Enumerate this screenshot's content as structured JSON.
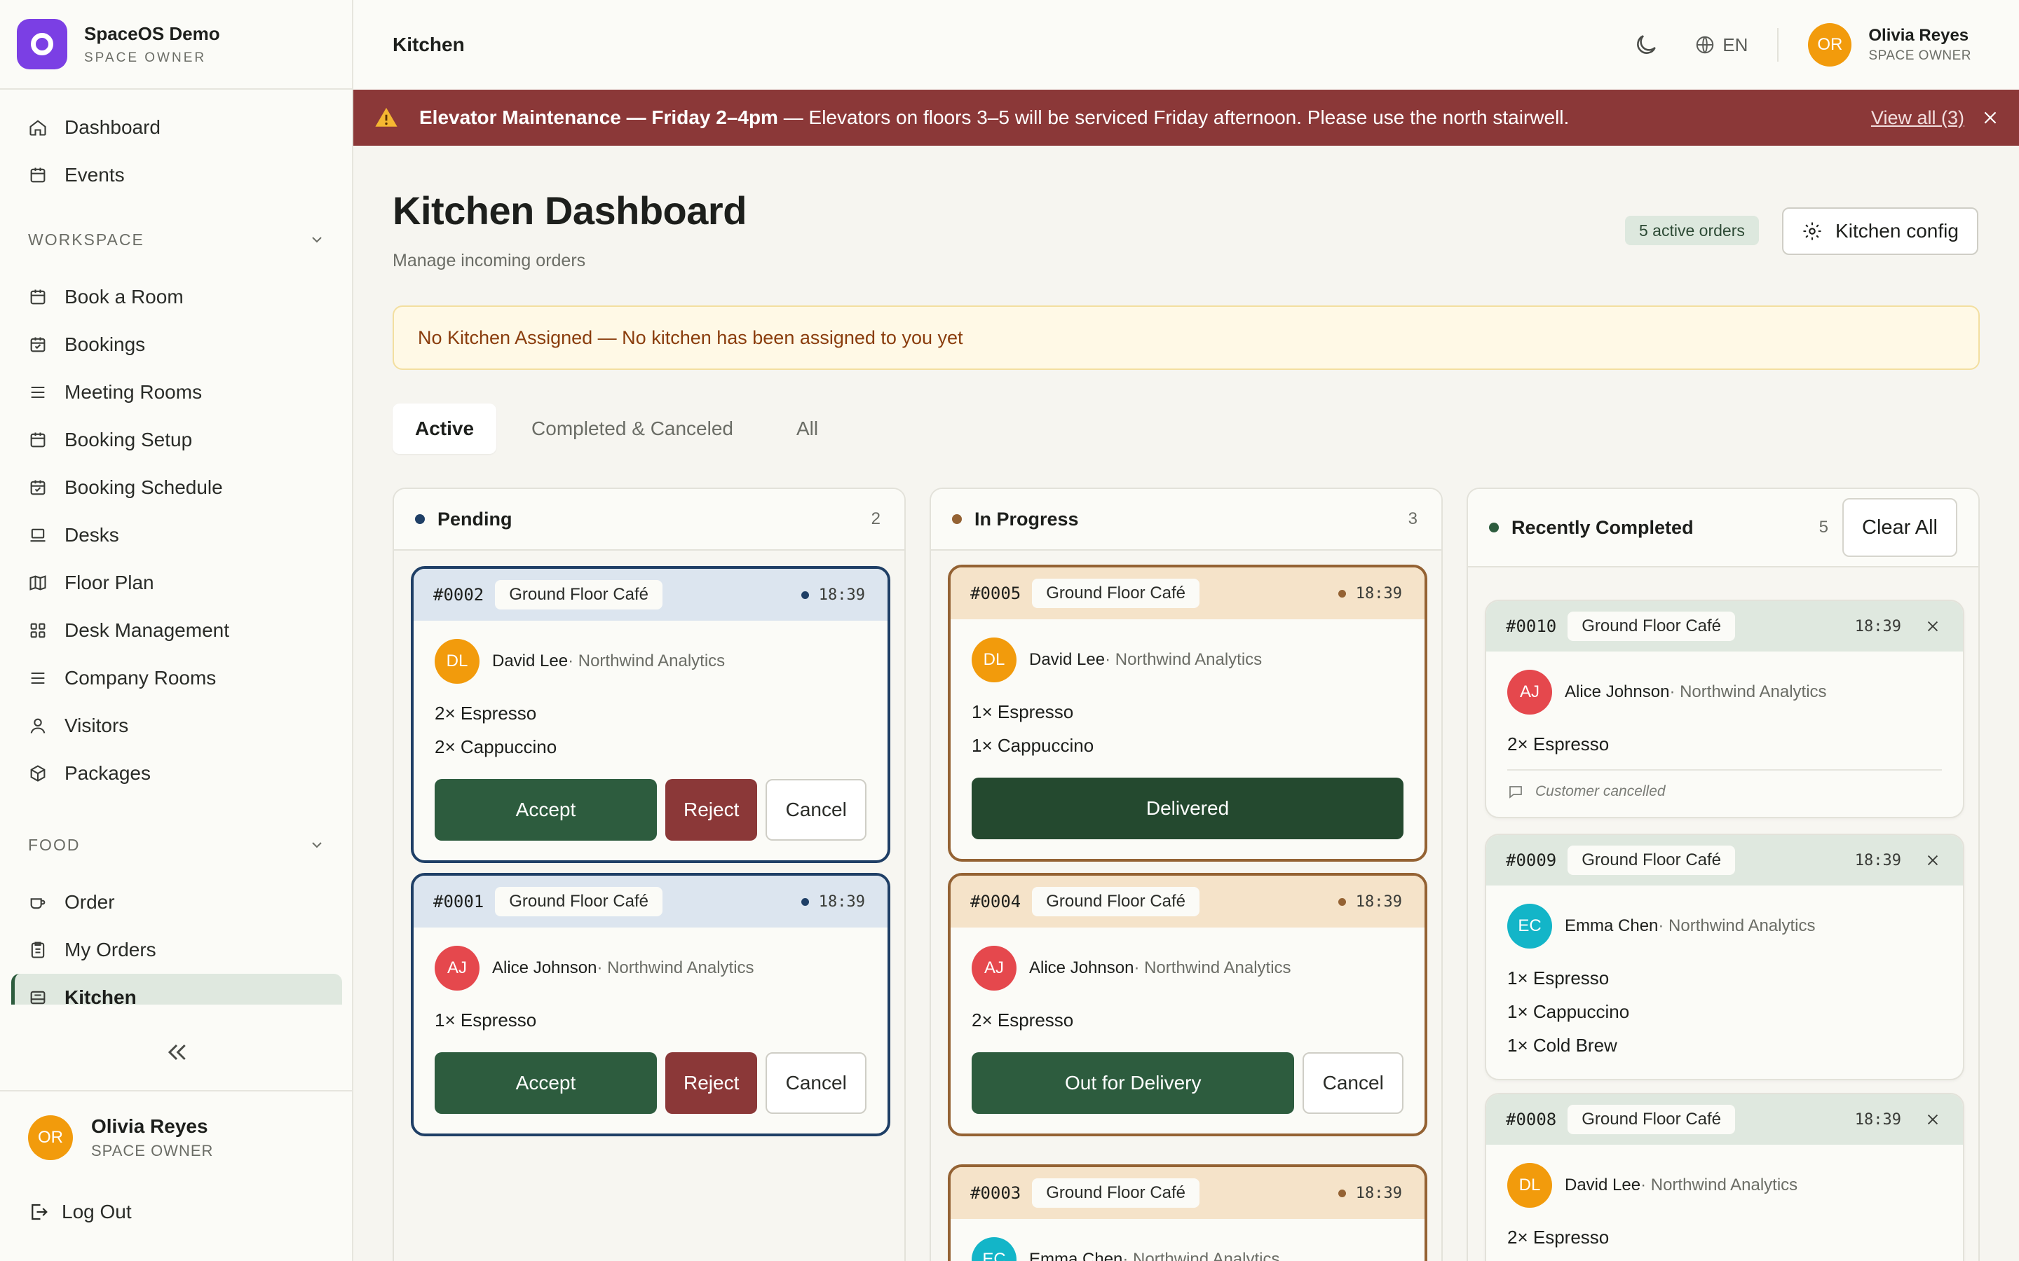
{
  "brand": {
    "name": "SpaceOS Demo",
    "role": "SPACE OWNER"
  },
  "nav": {
    "top": [
      {
        "label": "Dashboard",
        "icon": "home-icon"
      },
      {
        "label": "Events",
        "icon": "calendar-icon"
      }
    ],
    "workspace_title": "WORKSPACE",
    "workspace": [
      {
        "label": "Book a Room",
        "icon": "calendar-icon"
      },
      {
        "label": "Bookings",
        "icon": "calendar-check-icon"
      },
      {
        "label": "Meeting Rooms",
        "icon": "list-icon"
      },
      {
        "label": "Booking Setup",
        "icon": "calendar-icon"
      },
      {
        "label": "Booking Schedule",
        "icon": "calendar-check-icon"
      },
      {
        "label": "Desks",
        "icon": "laptop-icon"
      },
      {
        "label": "Floor Plan",
        "icon": "map-icon"
      },
      {
        "label": "Desk Management",
        "icon": "grid-icon"
      },
      {
        "label": "Company Rooms",
        "icon": "list-icon"
      },
      {
        "label": "Visitors",
        "icon": "user-icon"
      },
      {
        "label": "Packages",
        "icon": "package-icon"
      }
    ],
    "food_title": "FOOD",
    "food": [
      {
        "label": "Order",
        "icon": "cup-icon"
      },
      {
        "label": "My Orders",
        "icon": "clipboard-icon"
      },
      {
        "label": "Kitchen",
        "icon": "kitchen-icon"
      }
    ]
  },
  "user": {
    "initials": "OR",
    "name": "Olivia Reyes",
    "role": "SPACE OWNER",
    "avatar_color": "#f29b0c"
  },
  "logout_label": "Log Out",
  "topbar": {
    "title": "Kitchen",
    "lang": "EN"
  },
  "banner": {
    "title": "Elevator Maintenance — Friday 2–4pm",
    "message": " — Elevators on floors 3–5 will be serviced Friday afternoon. Please use the north stairwell.",
    "view_all": "View all (3)",
    "color": "#8b3838"
  },
  "page": {
    "title": "Kitchen Dashboard",
    "subtitle": "Manage incoming orders",
    "active_badge": "5 active orders",
    "config_label": "Kitchen config"
  },
  "notice": {
    "title": "No Kitchen Assigned",
    "message": " — No kitchen has been assigned to you yet"
  },
  "tabs": [
    "Active",
    "Completed & Canceled",
    "All"
  ],
  "columns": {
    "pending": {
      "title": "Pending",
      "count": "2",
      "dot": "#1f3f66",
      "orders": [
        {
          "id": "#0002",
          "location": "Ground Floor Café",
          "time": "18:39",
          "initials": "DL",
          "avatar": "#f29b0c",
          "name": "David Lee",
          "company": " · Northwind Analytics",
          "items": [
            "2× Espresso",
            "2× Cappuccino"
          ],
          "accept": "Accept",
          "reject": "Reject",
          "cancel": "Cancel"
        },
        {
          "id": "#0001",
          "location": "Ground Floor Café",
          "time": "18:39",
          "initials": "AJ",
          "avatar": "#e5484d",
          "name": "Alice Johnson",
          "company": " · Northwind Analytics",
          "items": [
            "1× Espresso"
          ],
          "accept": "Accept",
          "reject": "Reject",
          "cancel": "Cancel"
        }
      ]
    },
    "progress": {
      "title": "In Progress",
      "count": "3",
      "dot": "#946233",
      "orders": [
        {
          "id": "#0005",
          "location": "Ground Floor Café",
          "time": "18:39",
          "initials": "DL",
          "avatar": "#f29b0c",
          "name": "David Lee",
          "company": " · Northwind Analytics",
          "items": [
            "1× Espresso",
            "1× Cappuccino"
          ],
          "action": "Delivered"
        },
        {
          "id": "#0004",
          "location": "Ground Floor Café",
          "time": "18:39",
          "initials": "AJ",
          "avatar": "#e5484d",
          "name": "Alice Johnson",
          "company": " · Northwind Analytics",
          "items": [
            "2× Espresso"
          ],
          "action": "Out for Delivery",
          "cancel": "Cancel"
        },
        {
          "id": "#0003",
          "location": "Ground Floor Café",
          "time": "18:39",
          "initials": "EC",
          "avatar": "#13b5c8",
          "name": "Emma Chen",
          "company": " · Northwind Analytics",
          "items": []
        }
      ]
    },
    "done": {
      "title": "Recently Completed",
      "count": "5",
      "dot": "#2d5c3e",
      "clear": "Clear All",
      "orders": [
        {
          "id": "#0010",
          "location": "Ground Floor Café",
          "time": "18:39",
          "initials": "AJ",
          "avatar": "#e5484d",
          "name": "Alice Johnson",
          "company": " · Northwind Analytics",
          "items": [
            "2× Espresso"
          ],
          "note": "Customer cancelled"
        },
        {
          "id": "#0009",
          "location": "Ground Floor Café",
          "time": "18:39",
          "initials": "EC",
          "avatar": "#13b5c8",
          "name": "Emma Chen",
          "company": " · Northwind Analytics",
          "items": [
            "1× Espresso",
            "1× Cappuccino",
            "1× Cold Brew"
          ]
        },
        {
          "id": "#0008",
          "location": "Ground Floor Café",
          "time": "18:39",
          "initials": "DL",
          "avatar": "#f29b0c",
          "name": "David Lee",
          "company": " · Northwind Analytics",
          "items": [
            "2× Espresso"
          ]
        }
      ]
    }
  }
}
